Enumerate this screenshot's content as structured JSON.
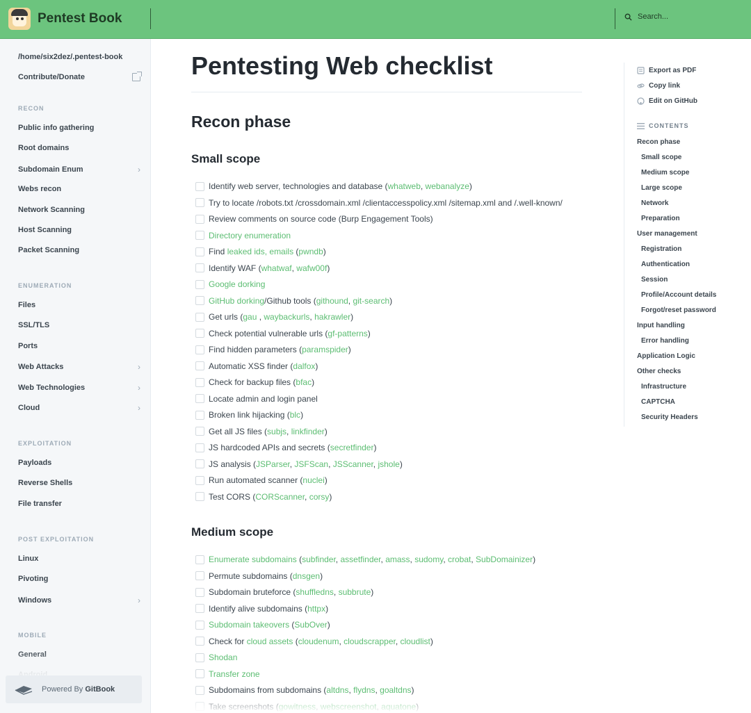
{
  "header": {
    "brand": "Pentest Book",
    "search_placeholder": "Search..."
  },
  "sidebar": {
    "path_item": "/home/six2dez/.pentest-book",
    "contribute": "Contribute/Donate",
    "sections": [
      {
        "label": "RECON",
        "items": [
          {
            "label": "Public info gathering",
            "chevron": false
          },
          {
            "label": "Root domains",
            "chevron": false
          },
          {
            "label": "Subdomain Enum",
            "chevron": true
          },
          {
            "label": "Webs recon",
            "chevron": false
          },
          {
            "label": "Network Scanning",
            "chevron": false
          },
          {
            "label": "Host Scanning",
            "chevron": false
          },
          {
            "label": "Packet Scanning",
            "chevron": false
          }
        ]
      },
      {
        "label": "ENUMERATION",
        "items": [
          {
            "label": "Files",
            "chevron": false
          },
          {
            "label": "SSL/TLS",
            "chevron": false
          },
          {
            "label": "Ports",
            "chevron": false
          },
          {
            "label": "Web Attacks",
            "chevron": true
          },
          {
            "label": "Web Technologies",
            "chevron": true
          },
          {
            "label": "Cloud",
            "chevron": true
          }
        ]
      },
      {
        "label": "EXPLOITATION",
        "items": [
          {
            "label": "Payloads",
            "chevron": false
          },
          {
            "label": "Reverse Shells",
            "chevron": false
          },
          {
            "label": "File transfer",
            "chevron": false
          }
        ]
      },
      {
        "label": "POST EXPLOITATION",
        "items": [
          {
            "label": "Linux",
            "chevron": false
          },
          {
            "label": "Pivoting",
            "chevron": false
          },
          {
            "label": "Windows",
            "chevron": true
          }
        ]
      },
      {
        "label": "MOBILE",
        "items": [
          {
            "label": "General",
            "chevron": false
          },
          {
            "label": "Android",
            "chevron": false
          }
        ]
      }
    ],
    "powered_prefix": "Powered By",
    "powered_brand": "GitBook"
  },
  "main": {
    "title": "Pentesting Web checklist",
    "h2": "Recon phase",
    "small_scope": {
      "heading": "Small scope",
      "tasks": [
        [
          [
            "t",
            "Identify web server, technologies and database ("
          ],
          [
            "l",
            "whatweb"
          ],
          [
            "t",
            ", "
          ],
          [
            "l",
            "webanalyze"
          ],
          [
            "t",
            ")"
          ]
        ],
        [
          [
            "t",
            "Try to locate /robots.txt /crossdomain.xml /clientaccesspolicy.xml /sitemap.xml and /.well-known/"
          ]
        ],
        [
          [
            "t",
            "Review comments on source code (Burp Engagement Tools)"
          ]
        ],
        [
          [
            "l",
            "Directory enumeration"
          ]
        ],
        [
          [
            "t",
            "Find "
          ],
          [
            "l",
            "leaked ids, emails"
          ],
          [
            "t",
            " ("
          ],
          [
            "l",
            "pwndb"
          ],
          [
            "t",
            ")"
          ]
        ],
        [
          [
            "t",
            "Identify WAF ("
          ],
          [
            "l",
            "whatwaf"
          ],
          [
            "t",
            ", "
          ],
          [
            "l",
            "wafw00f"
          ],
          [
            "t",
            ")"
          ]
        ],
        [
          [
            "l",
            "Google dorking"
          ]
        ],
        [
          [
            "l",
            "GitHub dorking"
          ],
          [
            "t",
            "/Github tools ("
          ],
          [
            "l",
            "githound"
          ],
          [
            "t",
            ", "
          ],
          [
            "l",
            "git-search"
          ],
          [
            "t",
            ")"
          ]
        ],
        [
          [
            "t",
            "Get urls ("
          ],
          [
            "l",
            "gau"
          ],
          [
            "t",
            " , "
          ],
          [
            "l",
            "waybackurls"
          ],
          [
            "t",
            ", "
          ],
          [
            "l",
            "hakrawler"
          ],
          [
            "t",
            ")"
          ]
        ],
        [
          [
            "t",
            "Check potential vulnerable urls ("
          ],
          [
            "l",
            "gf-patterns"
          ],
          [
            "t",
            ")"
          ]
        ],
        [
          [
            "t",
            "Find hidden parameters ("
          ],
          [
            "l",
            "paramspider"
          ],
          [
            "t",
            ")"
          ]
        ],
        [
          [
            "t",
            "Automatic XSS finder ("
          ],
          [
            "l",
            "dalfox"
          ],
          [
            "t",
            ")"
          ]
        ],
        [
          [
            "t",
            "Check for backup files ("
          ],
          [
            "l",
            "bfac"
          ],
          [
            "t",
            ")"
          ]
        ],
        [
          [
            "t",
            "Locate admin and login panel"
          ]
        ],
        [
          [
            "t",
            "Broken link hijacking ("
          ],
          [
            "l",
            "blc"
          ],
          [
            "t",
            ")"
          ]
        ],
        [
          [
            "t",
            "Get all JS files ("
          ],
          [
            "l",
            "subjs"
          ],
          [
            "t",
            ", "
          ],
          [
            "l",
            "linkfinder"
          ],
          [
            "t",
            ")"
          ]
        ],
        [
          [
            "t",
            "JS hardcoded APIs and secrets ("
          ],
          [
            "l",
            "secretfinder"
          ],
          [
            "t",
            ")"
          ]
        ],
        [
          [
            "t",
            "JS analysis ("
          ],
          [
            "l",
            "JSParser"
          ],
          [
            "t",
            ", "
          ],
          [
            "l",
            "JSFScan"
          ],
          [
            "t",
            ", "
          ],
          [
            "l",
            "JSScanner"
          ],
          [
            "t",
            ", "
          ],
          [
            "l",
            "jshole"
          ],
          [
            "t",
            ")"
          ]
        ],
        [
          [
            "t",
            "Run automated scanner ("
          ],
          [
            "l",
            "nuclei"
          ],
          [
            "t",
            ")"
          ]
        ],
        [
          [
            "t",
            "Test CORS ("
          ],
          [
            "l",
            "CORScanner"
          ],
          [
            "t",
            ", "
          ],
          [
            "l",
            "corsy"
          ],
          [
            "t",
            ")"
          ]
        ]
      ]
    },
    "medium_scope": {
      "heading": "Medium scope",
      "tasks": [
        [
          [
            "l",
            "Enumerate subdomains"
          ],
          [
            "t",
            " ("
          ],
          [
            "l",
            "subfinder"
          ],
          [
            "t",
            ", "
          ],
          [
            "l",
            "assetfinder"
          ],
          [
            "t",
            ", "
          ],
          [
            "l",
            "amass"
          ],
          [
            "t",
            ", "
          ],
          [
            "l",
            "sudomy"
          ],
          [
            "t",
            ", "
          ],
          [
            "l",
            "crobat"
          ],
          [
            "t",
            ", "
          ],
          [
            "l",
            "SubDomainizer"
          ],
          [
            "t",
            ")"
          ]
        ],
        [
          [
            "t",
            "Permute subdomains ("
          ],
          [
            "l",
            "dnsgen"
          ],
          [
            "t",
            ")"
          ]
        ],
        [
          [
            "t",
            "Subdomain bruteforce ("
          ],
          [
            "l",
            "shuffledns"
          ],
          [
            "t",
            ", "
          ],
          [
            "l",
            "subbrute"
          ],
          [
            "t",
            ")"
          ]
        ],
        [
          [
            "t",
            "Identify alive subdomains ("
          ],
          [
            "l",
            "httpx"
          ],
          [
            "t",
            ")"
          ]
        ],
        [
          [
            "l",
            "Subdomain takeovers"
          ],
          [
            "t",
            " ("
          ],
          [
            "l",
            "SubOver"
          ],
          [
            "t",
            ")"
          ]
        ],
        [
          [
            "t",
            "Check for "
          ],
          [
            "l",
            "cloud assets"
          ],
          [
            "t",
            " ("
          ],
          [
            "l",
            "cloudenum"
          ],
          [
            "t",
            ", "
          ],
          [
            "l",
            "cloudscrapper"
          ],
          [
            "t",
            ", "
          ],
          [
            "l",
            "cloudlist"
          ],
          [
            "t",
            ")"
          ]
        ],
        [
          [
            "l",
            "Shodan"
          ]
        ],
        [
          [
            "l",
            "Transfer zone"
          ]
        ],
        [
          [
            "t",
            "Subdomains from subdomains ("
          ],
          [
            "l",
            "altdns"
          ],
          [
            "t",
            ", "
          ],
          [
            "l",
            "flydns"
          ],
          [
            "t",
            ", "
          ],
          [
            "l",
            "goaltdns"
          ],
          [
            "t",
            ")"
          ]
        ],
        [
          [
            "t",
            "Take screenshots ("
          ],
          [
            "l",
            "gowitness"
          ],
          [
            "t",
            ", "
          ],
          [
            "l",
            "webscreenshot"
          ],
          [
            "t",
            ", "
          ],
          [
            "l",
            "aquatone"
          ],
          [
            "t",
            ")"
          ]
        ]
      ]
    }
  },
  "right_panel": {
    "actions": [
      {
        "label": "Export as PDF",
        "icon": "pdf-icon"
      },
      {
        "label": "Copy link",
        "icon": "link-icon"
      },
      {
        "label": "Edit on GitHub",
        "icon": "github-icon"
      }
    ],
    "contents_label": "CONTENTS",
    "toc": [
      {
        "label": "Recon phase",
        "level": 1
      },
      {
        "label": "Small scope",
        "level": 2
      },
      {
        "label": "Medium scope",
        "level": 2
      },
      {
        "label": "Large scope",
        "level": 2
      },
      {
        "label": "Network",
        "level": 2
      },
      {
        "label": "Preparation",
        "level": 2
      },
      {
        "label": "User management",
        "level": 1
      },
      {
        "label": "Registration",
        "level": 2
      },
      {
        "label": "Authentication",
        "level": 2
      },
      {
        "label": "Session",
        "level": 2
      },
      {
        "label": "Profile/Account details",
        "level": 2
      },
      {
        "label": "Forgot/reset password",
        "level": 2
      },
      {
        "label": "Input handling",
        "level": 1
      },
      {
        "label": "Error handling",
        "level": 2
      },
      {
        "label": "Application Logic",
        "level": 1
      },
      {
        "label": "Other checks",
        "level": 1
      },
      {
        "label": "Infrastructure",
        "level": 2
      },
      {
        "label": "CAPTCHA",
        "level": 2
      },
      {
        "label": "Security Headers",
        "level": 2
      }
    ]
  },
  "colors": {
    "header_bg": "#6cc47e",
    "link": "#5cbd72",
    "sidebar_bg": "#f5f7f9"
  }
}
